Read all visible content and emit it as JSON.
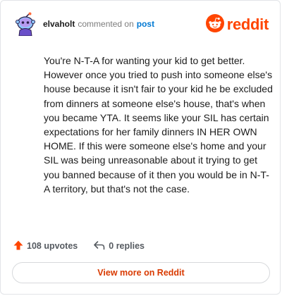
{
  "header": {
    "username": "elvaholt",
    "action_text": "commented on",
    "post_link": "post",
    "brand_name": "reddit"
  },
  "comment": {
    "body": "You're N-T-A for wanting your kid to get better. However once you tried to push into someone else's house because it isn't fair to your kid he be excluded from dinners at someone else's house, that's when you became YTA. It seems like your SIL has certain expectations for her family dinners IN HER OWN HOME. If this were someone else's home and your SIL was being unreasonable about it trying to get you banned because of it then you would be in N-T-A territory, but that's not the case."
  },
  "footer": {
    "upvotes": "108 upvotes",
    "replies": "0 replies"
  },
  "cta": {
    "label": "View more on Reddit"
  },
  "icons": {
    "avatar": "avatar-icon",
    "brand": "reddit-logo-icon",
    "upvote": "upvote-arrow-icon",
    "reply": "reply-arrow-icon"
  },
  "colors": {
    "brand": "#ff4500",
    "link": "#0079d3",
    "cta_text": "#d93a00",
    "text": "#1c1c1c",
    "muted": "#7c7c7c"
  }
}
